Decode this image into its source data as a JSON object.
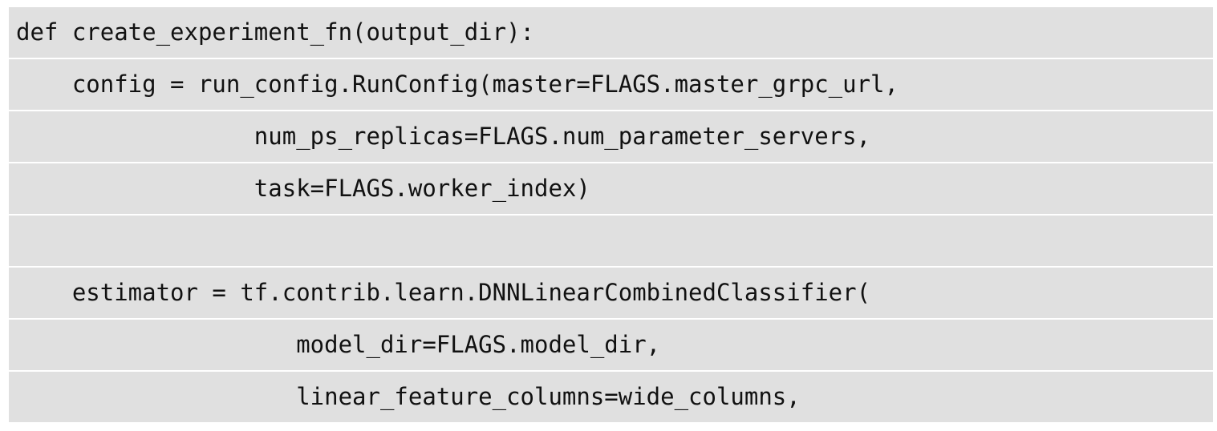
{
  "code": {
    "background": "#e0e0e0",
    "lines": [
      "def create_experiment_fn(output_dir):",
      "    config = run_config.RunConfig(master=FLAGS.master_grpc_url,",
      "                 num_ps_replicas=FLAGS.num_parameter_servers,",
      "                 task=FLAGS.worker_index)",
      "",
      "    estimator = tf.contrib.learn.DNNLinearCombinedClassifier(",
      "                    model_dir=FLAGS.model_dir,",
      "                    linear_feature_columns=wide_columns,"
    ]
  }
}
